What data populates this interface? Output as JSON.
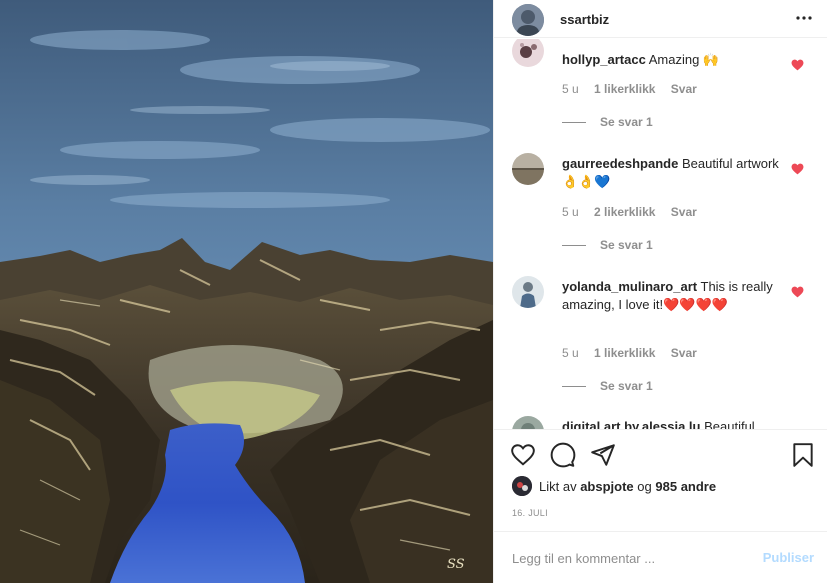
{
  "post": {
    "username": "ssartbiz",
    "artwork_signature": "SS",
    "more_icon": "more-horizontal-icon"
  },
  "comments": [
    {
      "username": "hollyp_artacc",
      "text": "Amazing 🙌",
      "age": "5 u",
      "likes": "1 likerklikk",
      "reply": "Svar",
      "view_replies": "Se svar 1",
      "liked": true
    },
    {
      "username": "gaurreedeshpande",
      "text": "Beautiful artwork 👌👌💙",
      "age": "5 u",
      "likes": "2 likerklikk",
      "reply": "Svar",
      "view_replies": "Se svar 1",
      "liked": true
    },
    {
      "username": "yolanda_mulinaro_art",
      "text": "This is really amazing, I love it!❤️❤️❤️❤️",
      "age": "5 u",
      "likes": "1 likerklikk",
      "reply": "Svar",
      "view_replies": "Se svar 1",
      "liked": true
    },
    {
      "username": "digital.art.by.alessia.lu",
      "text": "Beautiful"
    }
  ],
  "actions": {
    "like_icon": "heart-outline-icon",
    "comment_icon": "comment-icon",
    "share_icon": "paper-plane-icon",
    "save_icon": "bookmark-icon"
  },
  "likes": {
    "prefix": "Likt av",
    "user": "abspjote",
    "joiner": "og",
    "others": "985 andre"
  },
  "date": "16. JULI",
  "add_comment": {
    "placeholder": "Legg til en kommentar ...",
    "post_label": "Publiser"
  },
  "colors": {
    "heart_red": "#ed4956",
    "post_button": "#b3dbff",
    "secondary_text": "#8e8e8e"
  }
}
